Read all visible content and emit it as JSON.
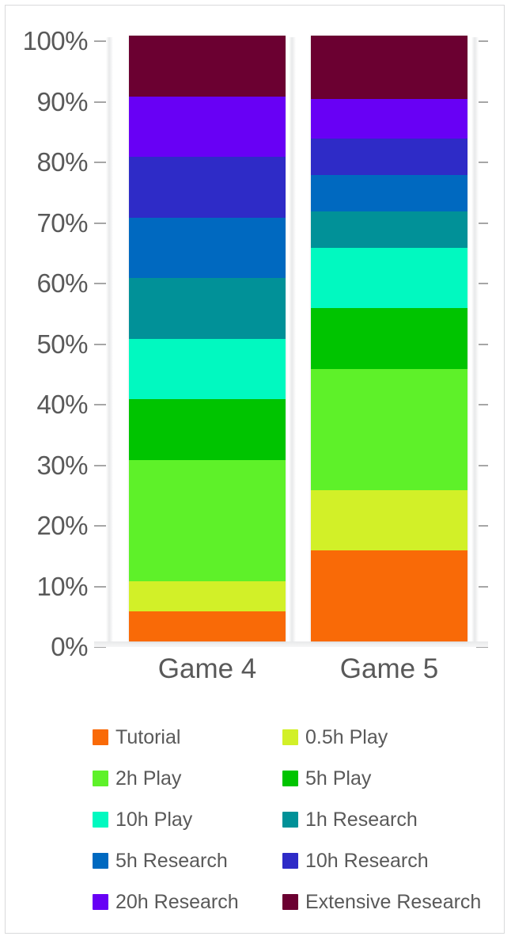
{
  "chart_data": {
    "type": "bar",
    "subtype": "stacked-100-percent",
    "title": "",
    "xlabel": "",
    "ylabel": "",
    "ylim": [
      0,
      100
    ],
    "y_tick_labels": [
      "0%",
      "10%",
      "20%",
      "30%",
      "40%",
      "50%",
      "60%",
      "70%",
      "80%",
      "90%",
      "100%"
    ],
    "y_tick_values": [
      0,
      10,
      20,
      30,
      40,
      50,
      60,
      70,
      80,
      90,
      100
    ],
    "grid": false,
    "legend_position": "bottom",
    "legend_columns": 2,
    "categories": [
      "Game 4",
      "Game 5"
    ],
    "series": [
      {
        "name": "Tutorial",
        "color": "#f96a07",
        "values": [
          5,
          15
        ]
      },
      {
        "name": "0.5h Play",
        "color": "#d2f028",
        "values": [
          5,
          10
        ]
      },
      {
        "name": "2h Play",
        "color": "#5ef129",
        "values": [
          20,
          20
        ]
      },
      {
        "name": "5h Play",
        "color": "#00c400",
        "values": [
          10,
          10
        ]
      },
      {
        "name": "10h Play",
        "color": "#01f9c0",
        "values": [
          10,
          10
        ]
      },
      {
        "name": "1h Research",
        "color": "#019198",
        "values": [
          10,
          6
        ]
      },
      {
        "name": "5h Research",
        "color": "#0069c0",
        "values": [
          10,
          6
        ]
      },
      {
        "name": "10h Research",
        "color": "#2e2bc7",
        "values": [
          10,
          6
        ]
      },
      {
        "name": "20h Research",
        "color": "#6800f5",
        "values": [
          10,
          6.5
        ]
      },
      {
        "name": "Extensive Research",
        "color": "#6b0031",
        "values": [
          10,
          10.5
        ]
      }
    ]
  },
  "legend": {
    "items": [
      {
        "label": "Tutorial",
        "color": "#f96a07"
      },
      {
        "label": "0.5h Play",
        "color": "#d2f028"
      },
      {
        "label": "2h Play",
        "color": "#5ef129"
      },
      {
        "label": "5h Play",
        "color": "#00c400"
      },
      {
        "label": "10h Play",
        "color": "#01f9c0"
      },
      {
        "label": "1h Research",
        "color": "#019198"
      },
      {
        "label": "5h Research",
        "color": "#0069c0"
      },
      {
        "label": "10h Research",
        "color": "#2e2bc7"
      },
      {
        "label": "20h Research",
        "color": "#6800f5"
      },
      {
        "label": "Extensive Research",
        "color": "#6b0031"
      }
    ]
  },
  "style": {
    "text_color": "#595959",
    "frame_color": "#d9dadb",
    "background": "#ffffff"
  }
}
